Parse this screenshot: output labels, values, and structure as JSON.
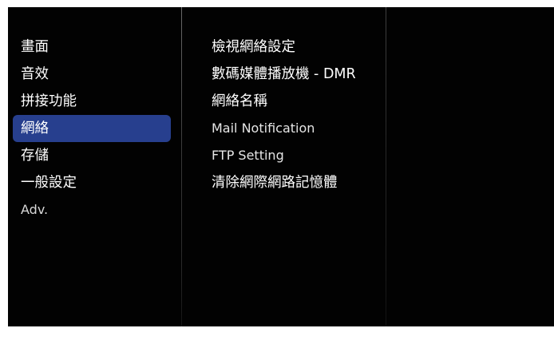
{
  "main_menu": {
    "items": [
      {
        "label": "畫面"
      },
      {
        "label": "音效"
      },
      {
        "label": "拼接功能"
      },
      {
        "label": "網絡"
      },
      {
        "label": "存儲"
      },
      {
        "label": "一般設定"
      },
      {
        "label": "Adv."
      }
    ],
    "selected_label": "網絡"
  },
  "sub_menu": {
    "items": [
      {
        "label": "檢視網絡設定"
      },
      {
        "label": "數碼媒體播放機 - DMR"
      },
      {
        "label": "網絡名稱"
      },
      {
        "label": "Mail Notification"
      },
      {
        "label": "FTP Setting"
      },
      {
        "label": "清除網際網路記憶體"
      }
    ]
  },
  "colors": {
    "background": "#020202",
    "selection": "#273f8e",
    "text": "#ffffff"
  }
}
